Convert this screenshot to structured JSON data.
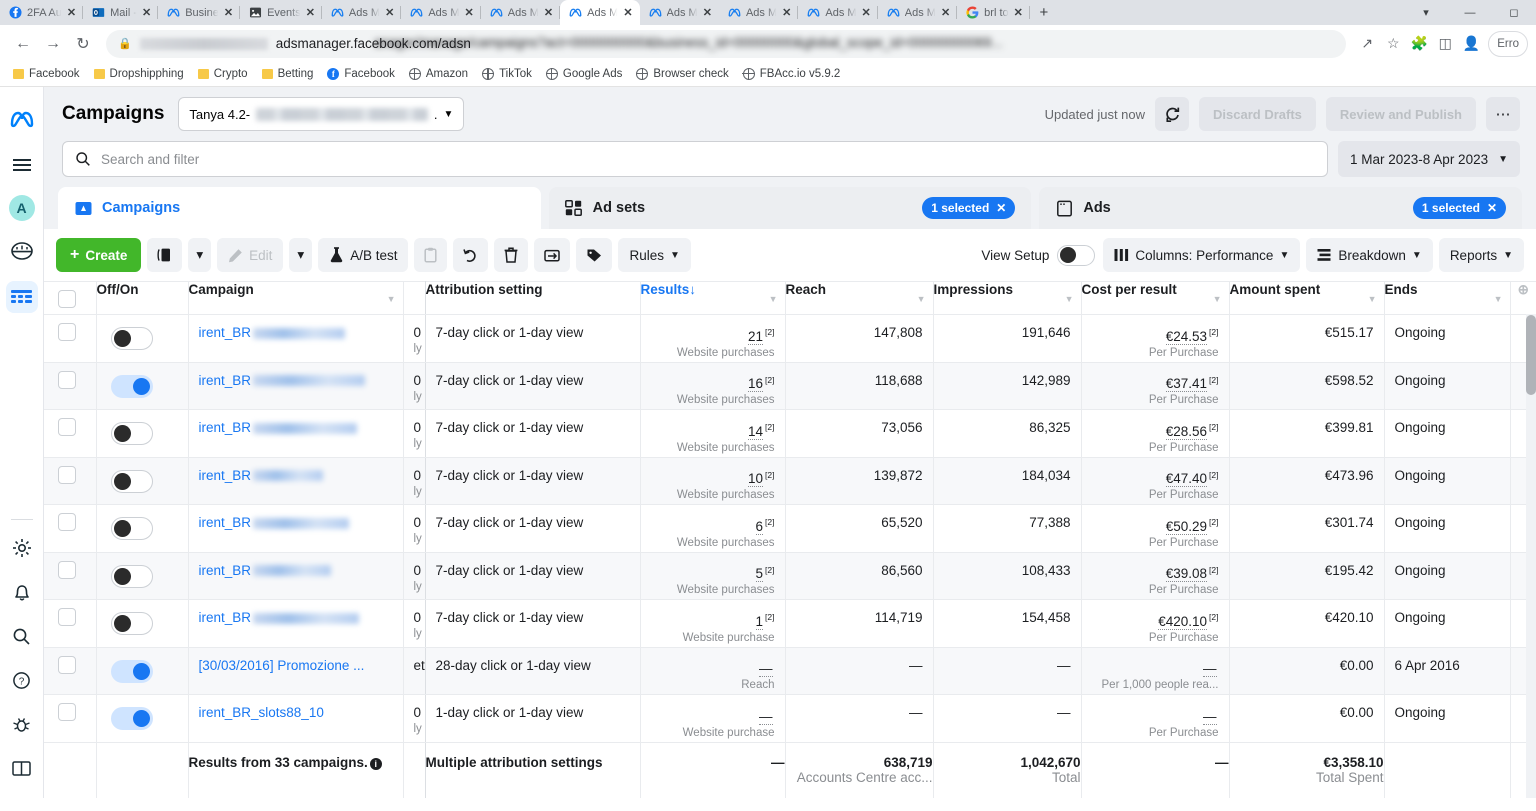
{
  "browser": {
    "tabs": [
      {
        "label": "2FA Au",
        "icon": "facebook-icon",
        "active": false
      },
      {
        "label": "Mail -",
        "icon": "outlook-icon",
        "active": false
      },
      {
        "label": "Busine",
        "icon": "meta-icon",
        "active": false
      },
      {
        "label": "Events",
        "icon": "events-icon",
        "active": false
      },
      {
        "label": "Ads M",
        "icon": "meta-icon",
        "active": false
      },
      {
        "label": "Ads M",
        "icon": "meta-icon",
        "active": false
      },
      {
        "label": "Ads M",
        "icon": "meta-icon",
        "active": false
      },
      {
        "label": "Ads M",
        "icon": "meta-icon",
        "active": true
      },
      {
        "label": "Ads M",
        "icon": "meta-icon",
        "active": false
      },
      {
        "label": "Ads M",
        "icon": "meta-icon",
        "active": false
      },
      {
        "label": "Ads M",
        "icon": "meta-icon",
        "active": false
      },
      {
        "label": "Ads M",
        "icon": "meta-icon",
        "active": false
      },
      {
        "label": "brl to",
        "icon": "google-icon",
        "active": false
      }
    ],
    "new_tab": "+",
    "window_controls": [
      "⌄",
      "—",
      "❑"
    ],
    "nav": {
      "back": "←",
      "forward": "→",
      "reload": "↻"
    },
    "url_visible": "adsmanager.facebook.com/adsn",
    "url_blurred": "anager/manage/campaigns?act=0000000000&business_id=00000000&global_scope_id=00000000069...",
    "toolbar_icons": [
      "share-icon",
      "bookmark-star-icon",
      "extensions-icon",
      "side-panel-icon",
      "profile-icon"
    ],
    "profile_label": "Erro",
    "bookmarks": [
      {
        "label": "Facebook",
        "icon": "folder-icon"
      },
      {
        "label": "Dropshipphing",
        "icon": "folder-icon"
      },
      {
        "label": "Crypto",
        "icon": "folder-icon"
      },
      {
        "label": "Betting",
        "icon": "folder-icon"
      },
      {
        "label": "Facebook",
        "icon": "facebook-icon"
      },
      {
        "label": "Amazon",
        "icon": "globe-icon"
      },
      {
        "label": "TikTok",
        "icon": "globe-icon"
      },
      {
        "label": "Google Ads",
        "icon": "globe-icon"
      },
      {
        "label": "Browser check",
        "icon": "globe-icon"
      },
      {
        "label": "FBAcc.io v5.9.2",
        "icon": "globe-icon"
      }
    ]
  },
  "rail": {
    "top": [
      {
        "name": "meta-logo-icon",
        "glyph": "∞"
      },
      {
        "name": "menu-icon",
        "glyph": "≡"
      },
      {
        "name": "account-avatar",
        "glyph": "A"
      },
      {
        "name": "pie-chart-icon",
        "glyph": "◔"
      },
      {
        "name": "table-view-icon",
        "glyph": "☰"
      }
    ],
    "bottom": [
      {
        "name": "settings-gear-icon",
        "glyph": "⚙"
      },
      {
        "name": "notifications-bell-icon",
        "glyph": "🔔"
      },
      {
        "name": "search-icon",
        "glyph": "🔍"
      },
      {
        "name": "help-icon",
        "glyph": "?"
      },
      {
        "name": "bug-report-icon",
        "glyph": "🐞"
      },
      {
        "name": "book-icon",
        "glyph": "☷"
      }
    ]
  },
  "header": {
    "title": "Campaigns",
    "account_prefix": "Tanya 4.2-",
    "account_suffix": ".",
    "updated": "Updated just now",
    "refresh_icon": "refresh-icon",
    "discard_drafts": "Discard Drafts",
    "review_publish": "Review and Publish",
    "more_menu": "⋯"
  },
  "search": {
    "placeholder": "Search and filter",
    "icon": "search-icon",
    "date_range": "1 Mar 2023-8 Apr 2023"
  },
  "levels": [
    {
      "label": "Campaigns",
      "icon": "campaign-icon",
      "active": true,
      "badge": null
    },
    {
      "label": "Ad sets",
      "icon": "adset-icon",
      "active": false,
      "badge": "1 selected"
    },
    {
      "label": "Ads",
      "icon": "ads-icon",
      "active": false,
      "badge": "1 selected"
    }
  ],
  "toolbar": {
    "create": "Create",
    "duplicate_icon": "duplicate-icon",
    "duplicate_caret": "▾",
    "edit": "Edit",
    "edit_caret": "▾",
    "ab_test": "A/B test",
    "ab_icon": "flask-icon",
    "copy_icon": "clipboard-icon",
    "undo_icon": "undo-icon",
    "delete_icon": "trash-icon",
    "export_icon": "export-icon",
    "tag_icon": "tag-icon",
    "rules": "Rules",
    "rules_caret": "▾",
    "view_setup": "View Setup",
    "view_setup_on": false,
    "columns": "Columns: Performance",
    "columns_icon": "columns-icon",
    "breakdown": "Breakdown",
    "breakdown_icon": "breakdown-icon",
    "reports": "Reports",
    "caret": "▾"
  },
  "table": {
    "columns": [
      {
        "key": "checkbox",
        "label": ""
      },
      {
        "key": "offon",
        "label": "Off/On"
      },
      {
        "key": "campaign",
        "label": "Campaign",
        "caret": true
      },
      {
        "key": "budget",
        "label": ""
      },
      {
        "key": "attribution",
        "label": "Attribution setting"
      },
      {
        "key": "results",
        "label": "Results",
        "sorted": true,
        "sort_arrow": "↓",
        "caret": true
      },
      {
        "key": "reach",
        "label": "Reach",
        "caret": true
      },
      {
        "key": "impressions",
        "label": "Impressions",
        "caret": true
      },
      {
        "key": "cpr",
        "label": "Cost per result",
        "caret": true
      },
      {
        "key": "spent",
        "label": "Amount spent",
        "caret": true
      },
      {
        "key": "ends",
        "label": "Ends",
        "caret": true
      },
      {
        "key": "addcol",
        "label": "⊕"
      }
    ],
    "rows": [
      {
        "on": false,
        "name_prefix": "irent_BR",
        "name_blur_w": 92,
        "budget": "0",
        "budget_sub": "ly",
        "attribution": "7-day click or 1-day view",
        "results": "21",
        "results_sup": "[2]",
        "results_sub": "Website purchases",
        "reach": "147,808",
        "impressions": "191,646",
        "cpr": "€24.53",
        "cpr_sup": "[2]",
        "cpr_sub": "Per Purchase",
        "spent": "€515.17",
        "ends": "Ongoing"
      },
      {
        "on": true,
        "name_prefix": "irent_BR",
        "name_blur_w": 112,
        "budget": "0",
        "budget_sub": "ly",
        "attribution": "7-day click or 1-day view",
        "results": "16",
        "results_sup": "[2]",
        "results_sub": "Website purchases",
        "reach": "118,688",
        "impressions": "142,989",
        "cpr": "€37.41",
        "cpr_sup": "[2]",
        "cpr_sub": "Per Purchase",
        "spent": "€598.52",
        "ends": "Ongoing"
      },
      {
        "on": false,
        "name_prefix": "irent_BR",
        "name_blur_w": 104,
        "budget": "0",
        "budget_sub": "ly",
        "attribution": "7-day click or 1-day view",
        "results": "14",
        "results_sup": "[2]",
        "results_sub": "Website purchases",
        "reach": "73,056",
        "impressions": "86,325",
        "cpr": "€28.56",
        "cpr_sup": "[2]",
        "cpr_sub": "Per Purchase",
        "spent": "€399.81",
        "ends": "Ongoing"
      },
      {
        "on": false,
        "name_prefix": "irent_BR",
        "name_blur_w": 70,
        "budget": "0",
        "budget_sub": "ly",
        "attribution": "7-day click or 1-day view",
        "results": "10",
        "results_sup": "[2]",
        "results_sub": "Website purchases",
        "reach": "139,872",
        "impressions": "184,034",
        "cpr": "€47.40",
        "cpr_sup": "[2]",
        "cpr_sub": "Per Purchase",
        "spent": "€473.96",
        "ends": "Ongoing"
      },
      {
        "on": false,
        "name_prefix": "irent_BR",
        "name_blur_w": 96,
        "budget": "0",
        "budget_sub": "ly",
        "attribution": "7-day click or 1-day view",
        "results": "6",
        "results_sup": "[2]",
        "results_sub": "Website purchases",
        "reach": "65,520",
        "impressions": "77,388",
        "cpr": "€50.29",
        "cpr_sup": "[2]",
        "cpr_sub": "Per Purchase",
        "spent": "€301.74",
        "ends": "Ongoing"
      },
      {
        "on": false,
        "name_prefix": "irent_BR",
        "name_blur_w": 78,
        "budget": "0",
        "budget_sub": "ly",
        "attribution": "7-day click or 1-day view",
        "results": "5",
        "results_sup": "[2]",
        "results_sub": "Website purchases",
        "reach": "86,560",
        "impressions": "108,433",
        "cpr": "€39.08",
        "cpr_sup": "[2]",
        "cpr_sub": "Per Purchase",
        "spent": "€195.42",
        "ends": "Ongoing"
      },
      {
        "on": false,
        "name_prefix": "irent_BR",
        "name_blur_w": 106,
        "budget": "0",
        "budget_sub": "ly",
        "attribution": "7-day click or 1-day view",
        "results": "1",
        "results_sup": "[2]",
        "results_sub": "Website purchase",
        "reach": "114,719",
        "impressions": "154,458",
        "cpr": "€420.10",
        "cpr_sup": "[2]",
        "cpr_sub": "Per Purchase",
        "spent": "€420.10",
        "ends": "Ongoing"
      },
      {
        "on": true,
        "name_prefix": "[30/03/2016] Promozione ...",
        "name_blur_w": 0,
        "budget": "et",
        "budget_sub": "",
        "attribution": "28-day click or 1-day view",
        "results": "—",
        "results_sup": "",
        "results_sub": "Reach",
        "reach": "—",
        "impressions": "—",
        "cpr": "—",
        "cpr_sup": "",
        "cpr_sub": "Per 1,000 people rea...",
        "spent": "€0.00",
        "ends": "6 Apr 2016"
      },
      {
        "on": true,
        "name_prefix": "irent_BR_slots88_10",
        "name_blur_w": 0,
        "budget": "0",
        "budget_sub": "ly",
        "attribution": "1-day click or 1-day view",
        "results": "—",
        "results_sup": "",
        "results_sub": "Website purchase",
        "reach": "—",
        "impressions": "—",
        "cpr": "—",
        "cpr_sup": "",
        "cpr_sub": "Per Purchase",
        "spent": "€0.00",
        "ends": "Ongoing"
      }
    ],
    "footer": {
      "campaign": "Results from 33 campaigns.",
      "attribution": "Multiple attribution settings",
      "results": "—",
      "reach": "638,719",
      "reach_sub": "Accounts Centre acc...",
      "impressions": "1,042,670",
      "impressions_sub": "Total",
      "cpr": "—",
      "spent": "€3,358.10",
      "spent_sub": "Total Spent",
      "ends": ""
    }
  }
}
